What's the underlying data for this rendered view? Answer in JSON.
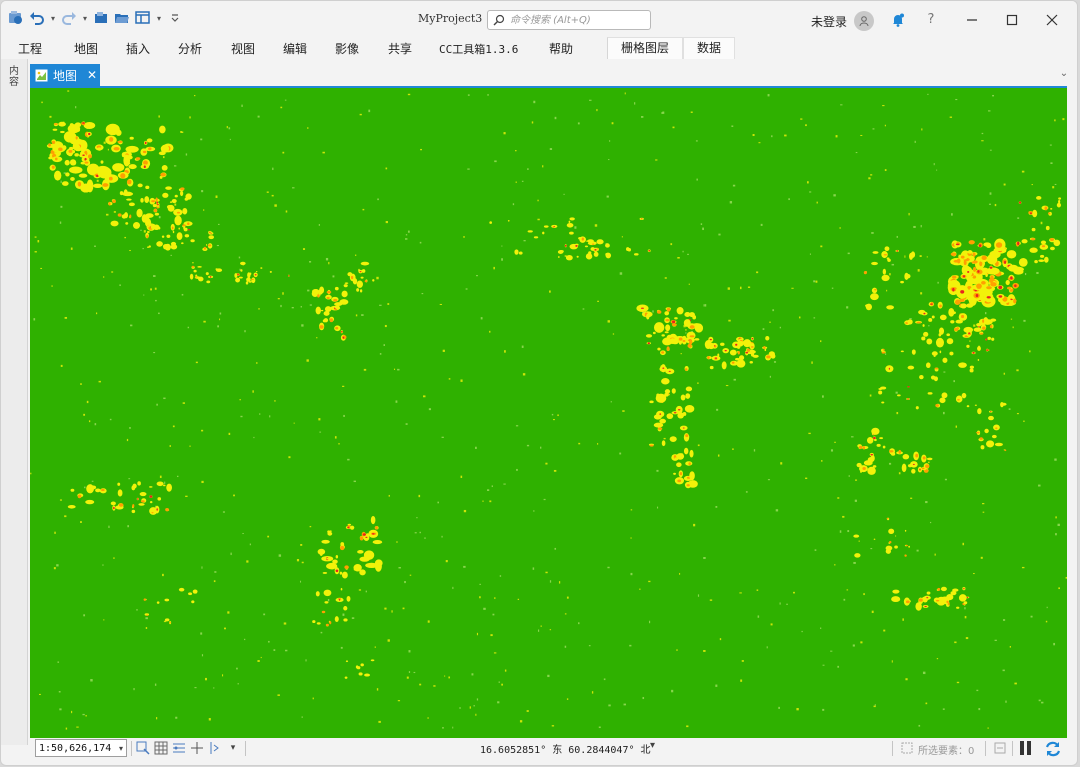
{
  "app": {
    "project_title": "MyProject3",
    "search_placeholder": "命令搜索 (Alt+Q)",
    "user_label": "未登录",
    "window_controls": [
      "minimize-icon",
      "maximize-icon",
      "close-icon"
    ]
  },
  "quick_access": [
    {
      "name": "project-icon"
    },
    {
      "name": "undo-icon"
    },
    {
      "name": "redo-icon"
    },
    {
      "name": "new-project-icon"
    },
    {
      "name": "open-project-icon"
    },
    {
      "name": "view-icon"
    },
    {
      "name": "customize-icon"
    }
  ],
  "ribbon": {
    "tabs": [
      "工程",
      "地图",
      "插入",
      "分析",
      "视图",
      "编辑",
      "影像",
      "共享",
      "CC工具箱1.3.6",
      "帮助"
    ],
    "context_tabs": [
      "栅格图层",
      "数据"
    ]
  },
  "side_pane": {
    "label": "内容"
  },
  "document_tab": {
    "label": "地图"
  },
  "map": {
    "background_color": "#2fb100",
    "legend_colors": [
      "#2fb100",
      "#f2f20a",
      "#ffa000",
      "#e8231e"
    ]
  },
  "status": {
    "scale": "1:50,626,174",
    "coordinates": "16.6052851° 东 60.2844047° 北",
    "selected_label": "所选要素：0"
  }
}
